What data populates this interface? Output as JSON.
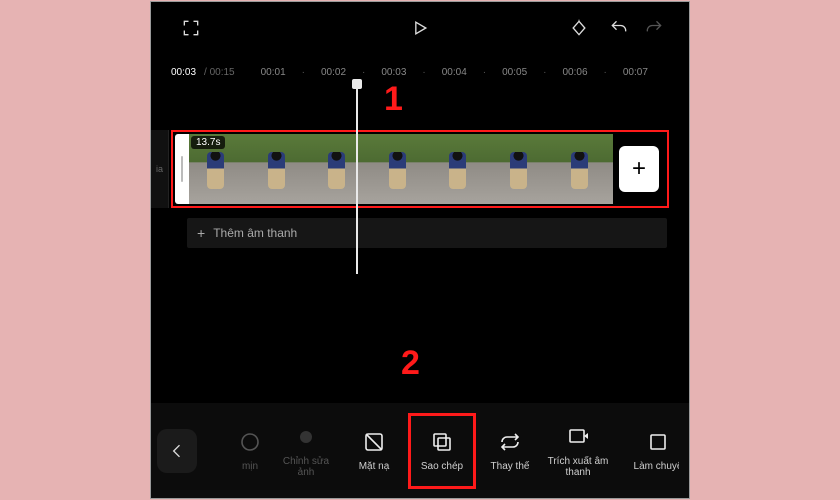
{
  "annotations": {
    "one": "1",
    "two": "2"
  },
  "time": {
    "current": "00:03",
    "total": "00:15",
    "ticks": [
      "00:01",
      "00:02",
      "00:03",
      "00:04",
      "00:05",
      "00:06",
      "00:07"
    ]
  },
  "clip": {
    "duration": "13.7s"
  },
  "audio": {
    "add_label": "Thêm âm thanh"
  },
  "left_tab": "ia",
  "add_tile": "+",
  "tools": {
    "back": "‹",
    "min": "mịn",
    "edit_photo": "Chỉnh sửa ảnh",
    "mask": "Mặt nạ",
    "copy": "Sao chép",
    "replace": "Thay thế",
    "extract_audio": "Trích xuất âm thanh",
    "transform": "Làm chuyể"
  }
}
